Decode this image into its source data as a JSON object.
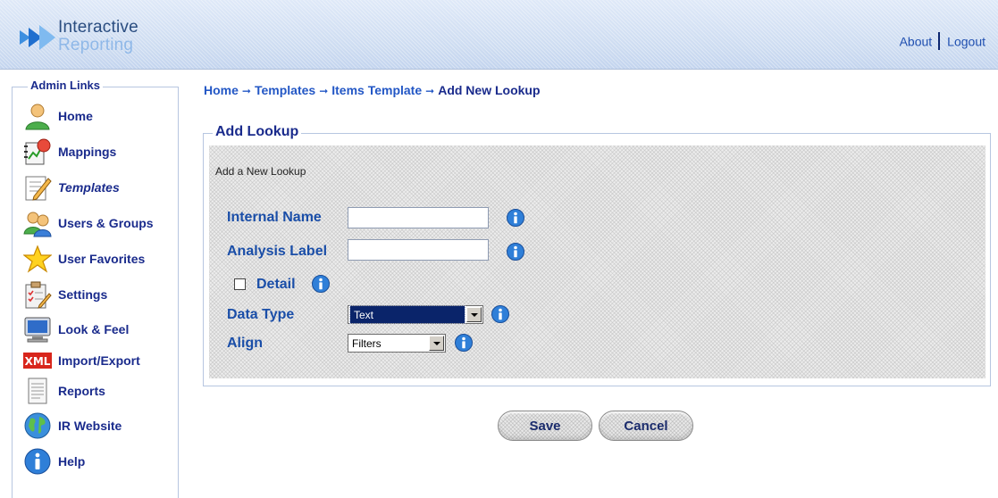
{
  "header": {
    "logo_line1": "Interactive",
    "logo_line2": "Reporting",
    "about": "About",
    "logout": "Logout"
  },
  "sidebar": {
    "title": "Admin Links",
    "items": [
      {
        "label": "Home",
        "icon": "user-icon"
      },
      {
        "label": "Mappings",
        "icon": "mappings-icon"
      },
      {
        "label": "Templates",
        "icon": "templates-icon",
        "active": true
      },
      {
        "label": "Users & Groups",
        "icon": "users-groups-icon"
      },
      {
        "label": "User Favorites",
        "icon": "star-icon"
      },
      {
        "label": "Settings",
        "icon": "settings-icon"
      },
      {
        "label": "Look & Feel",
        "icon": "monitor-icon"
      },
      {
        "label": "Import/Export",
        "icon": "xml-icon",
        "badge": "XML"
      },
      {
        "label": "Reports",
        "icon": "report-icon"
      },
      {
        "label": "IR Website",
        "icon": "globe-icon"
      },
      {
        "label": "Help",
        "icon": "help-icon"
      }
    ]
  },
  "breadcrumb": [
    "Home",
    "Templates",
    "Items Template",
    "Add New Lookup"
  ],
  "form": {
    "legend": "Add Lookup",
    "subtitle": "Add a New Lookup",
    "internal_name": {
      "label": "Internal Name",
      "value": ""
    },
    "analysis_label": {
      "label": "Analysis Label",
      "value": ""
    },
    "detail": {
      "label": "Detail",
      "checked": false
    },
    "data_type": {
      "label": "Data Type",
      "value": "Text"
    },
    "align": {
      "label": "Align",
      "value": "Filters"
    }
  },
  "buttons": {
    "save": "Save",
    "cancel": "Cancel"
  },
  "colors": {
    "label_blue": "#1a4ea8",
    "nav_text": "#1a2b8c",
    "info_blue": "#2f7fd8"
  }
}
